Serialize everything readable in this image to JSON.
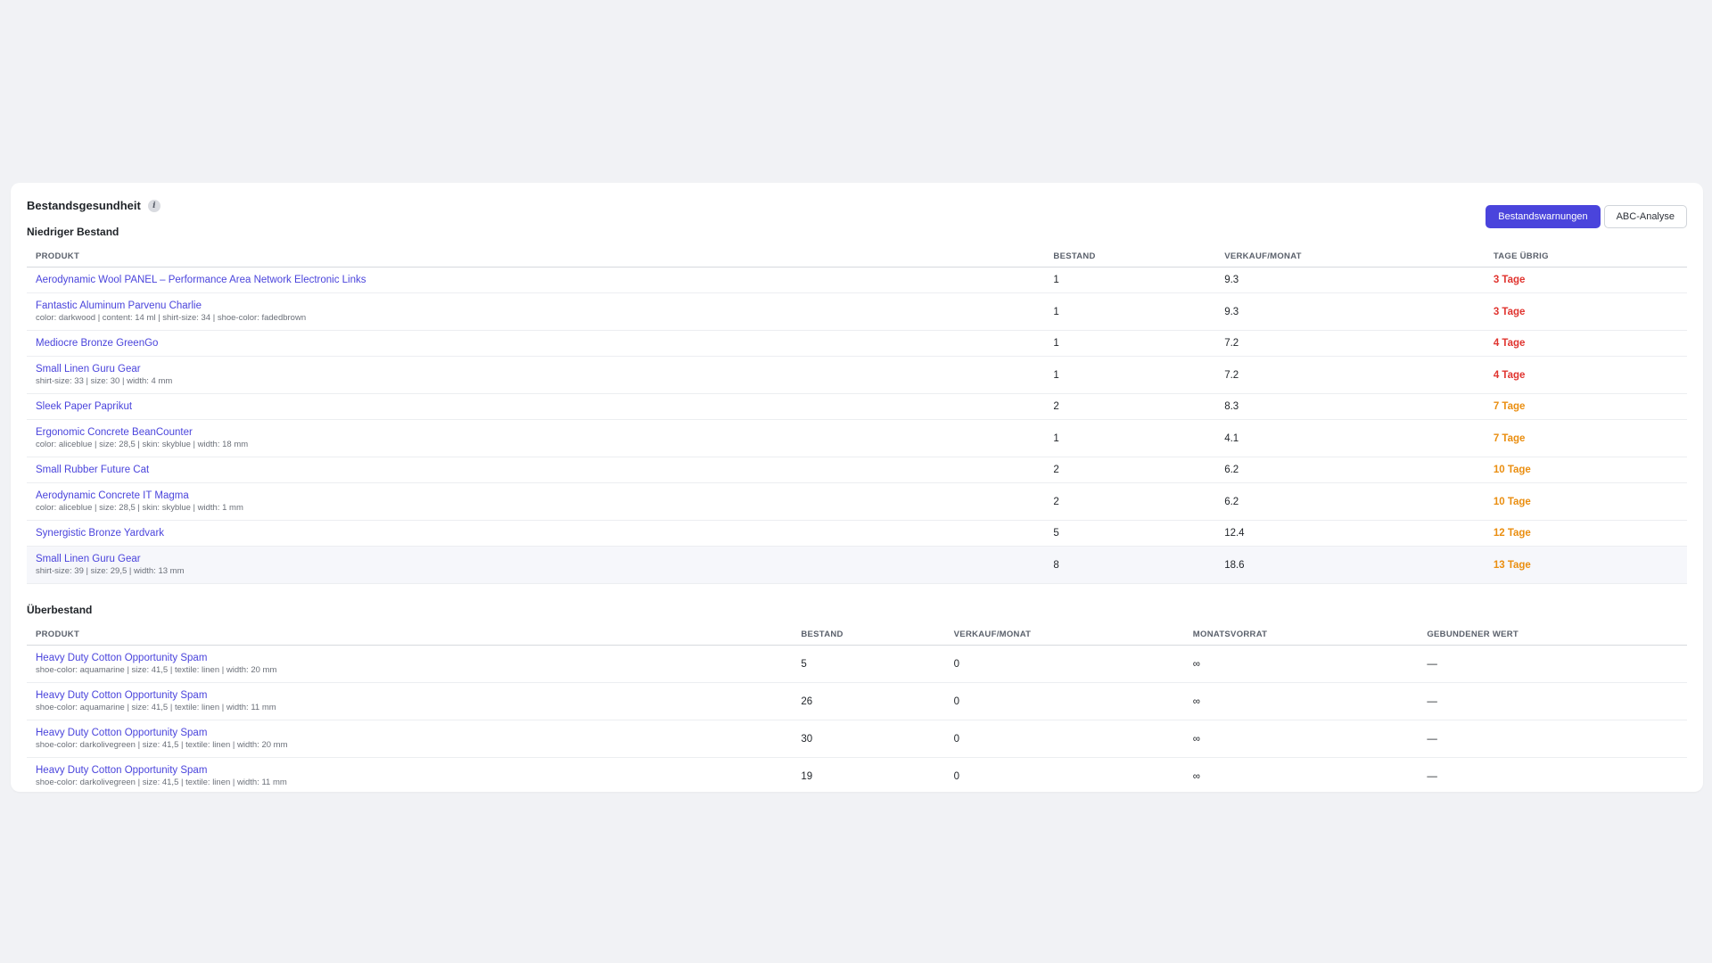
{
  "card": {
    "title": "Bestandsgesundheit",
    "info_glyph": "i",
    "tabs": [
      {
        "label": "Bestandswarnungen",
        "active": true
      },
      {
        "label": "ABC-Analyse",
        "active": false
      }
    ]
  },
  "low_stock": {
    "title": "Niedriger Bestand",
    "columns": [
      "PRODUKT",
      "BESTAND",
      "VERKAUF/MONAT",
      "TAGE ÜBRIG"
    ],
    "rows": [
      {
        "name": "Aerodynamic Wool PANEL – Performance Area Network Electronic Links",
        "sub": "",
        "stock": "1",
        "sales": "9.3",
        "days": "3 Tage",
        "severity": "red"
      },
      {
        "name": "Fantastic Aluminum Parvenu Charlie",
        "sub": "color: darkwood | content: 14 ml | shirt-size: 34 | shoe-color: fadedbrown",
        "stock": "1",
        "sales": "9.3",
        "days": "3 Tage",
        "severity": "red"
      },
      {
        "name": "Mediocre Bronze GreenGo",
        "sub": "",
        "stock": "1",
        "sales": "7.2",
        "days": "4 Tage",
        "severity": "red"
      },
      {
        "name": "Small Linen Guru Gear",
        "sub": "shirt-size: 33 | size: 30 | width: 4 mm",
        "stock": "1",
        "sales": "7.2",
        "days": "4 Tage",
        "severity": "red"
      },
      {
        "name": "Sleek Paper Paprikut",
        "sub": "",
        "stock": "2",
        "sales": "8.3",
        "days": "7 Tage",
        "severity": "orange"
      },
      {
        "name": "Ergonomic Concrete BeanCounter",
        "sub": "color: aliceblue | size: 28,5 | skin: skyblue | width: 18 mm",
        "stock": "1",
        "sales": "4.1",
        "days": "7 Tage",
        "severity": "orange"
      },
      {
        "name": "Small Rubber Future Cat",
        "sub": "",
        "stock": "2",
        "sales": "6.2",
        "days": "10 Tage",
        "severity": "orange"
      },
      {
        "name": "Aerodynamic Concrete IT Magma",
        "sub": "color: aliceblue | size: 28,5 | skin: skyblue | width: 1 mm",
        "stock": "2",
        "sales": "6.2",
        "days": "10 Tage",
        "severity": "orange"
      },
      {
        "name": "Synergistic Bronze Yardvark",
        "sub": "",
        "stock": "5",
        "sales": "12.4",
        "days": "12 Tage",
        "severity": "orange"
      },
      {
        "name": "Small Linen Guru Gear",
        "sub": "shirt-size: 39 | size: 29,5 | width: 13 mm",
        "stock": "8",
        "sales": "18.6",
        "days": "13 Tage",
        "severity": "orange"
      }
    ]
  },
  "overstock": {
    "title": "Überbestand",
    "columns": [
      "PRODUKT",
      "BESTAND",
      "VERKAUF/MONAT",
      "MONATSVORRAT",
      "GEBUNDENER WERT"
    ],
    "rows": [
      {
        "name": "Heavy Duty Cotton Opportunity Spam",
        "sub": "shoe-color: aquamarine | size: 41,5 | textile: linen | width: 20 mm",
        "stock": "5",
        "sales": "0",
        "supply": "∞",
        "value": "—"
      },
      {
        "name": "Heavy Duty Cotton Opportunity Spam",
        "sub": "shoe-color: aquamarine | size: 41,5 | textile: linen | width: 11 mm",
        "stock": "26",
        "sales": "0",
        "supply": "∞",
        "value": "—"
      },
      {
        "name": "Heavy Duty Cotton Opportunity Spam",
        "sub": "shoe-color: darkolivegreen | size: 41,5 | textile: linen | width: 20 mm",
        "stock": "30",
        "sales": "0",
        "supply": "∞",
        "value": "—"
      },
      {
        "name": "Heavy Duty Cotton Opportunity Spam",
        "sub": "shoe-color: darkolivegreen | size: 41,5 | textile: linen | width: 11 mm",
        "stock": "19",
        "sales": "0",
        "supply": "∞",
        "value": "—"
      }
    ]
  },
  "colors": {
    "accent": "#4a44dc",
    "danger": "#e0342f",
    "warning": "#ea8e10"
  }
}
